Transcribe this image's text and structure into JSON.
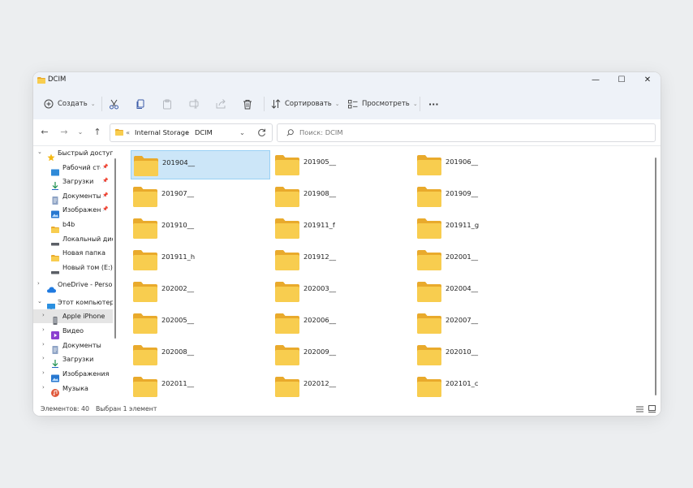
{
  "window": {
    "title": "DCIM",
    "controls": {
      "minimize": "—",
      "maximize": "☐",
      "close": "✕"
    }
  },
  "toolbar": {
    "create_label": "Создать",
    "sort_label": "Сортировать",
    "view_label": "Просмотреть",
    "more_label": "···"
  },
  "address": {
    "overflow": "«",
    "segments": [
      "Internal Storage",
      "DCIM"
    ],
    "separator": "›"
  },
  "search": {
    "placeholder": "Поиск: DCIM"
  },
  "sidebar": {
    "items": [
      {
        "label": "Быстрый доступ",
        "icon": "star-icon",
        "expander": "⌄",
        "pinned": false
      },
      {
        "label": "Рабочий сто...",
        "icon": "desktop-icon",
        "expander": "",
        "pinned": true
      },
      {
        "label": "Загрузки",
        "icon": "download-icon",
        "expander": "",
        "pinned": true
      },
      {
        "label": "Документы",
        "icon": "document-icon",
        "expander": "",
        "pinned": true
      },
      {
        "label": "Изображени",
        "icon": "image-icon",
        "expander": "",
        "pinned": true
      },
      {
        "label": "b4b",
        "icon": "folder-icon",
        "expander": "",
        "pinned": false
      },
      {
        "label": "Локальный дис",
        "icon": "drive-icon",
        "expander": "",
        "pinned": false
      },
      {
        "label": "Новая папка",
        "icon": "folder-icon",
        "expander": "",
        "pinned": false
      },
      {
        "label": "Новый том (E:)",
        "icon": "drive-icon",
        "expander": "",
        "pinned": false
      },
      {
        "label": "OneDrive - Person",
        "icon": "cloud-icon",
        "expander": "›",
        "pinned": false
      },
      {
        "label": "Этот компьютер",
        "icon": "computer-icon",
        "expander": "⌄",
        "pinned": false
      },
      {
        "label": "Apple iPhone",
        "icon": "phone-icon",
        "expander": "›",
        "pinned": false,
        "selected": true
      },
      {
        "label": "Видео",
        "icon": "video-icon",
        "expander": "›",
        "pinned": false
      },
      {
        "label": "Документы",
        "icon": "document-icon",
        "expander": "›",
        "pinned": false
      },
      {
        "label": "Загрузки",
        "icon": "download-icon",
        "expander": "›",
        "pinned": false
      },
      {
        "label": "Изображения",
        "icon": "image-icon",
        "expander": "›",
        "pinned": false
      },
      {
        "label": "Музыка",
        "icon": "music-icon",
        "expander": "›",
        "pinned": false
      }
    ]
  },
  "folders": [
    "201904__",
    "201905__",
    "201906__",
    "201907__",
    "201908__",
    "201909__",
    "201910__",
    "201911_f",
    "201911_g",
    "201911_h",
    "201912__",
    "202001__",
    "202002__",
    "202003__",
    "202004__",
    "202005__",
    "202006__",
    "202007__",
    "202008__",
    "202009__",
    "202010__",
    "202011__",
    "202012__",
    "202101_c"
  ],
  "selected_folder": "201904__",
  "status": {
    "count": "Элементов: 40",
    "selection": "Выбран 1 элемент"
  },
  "colors": {
    "folder_fill": "#f8cd4f",
    "folder_back": "#e9aa2c",
    "selection_bg": "#cce6f8",
    "chrome_bg": "#eef2f8"
  }
}
